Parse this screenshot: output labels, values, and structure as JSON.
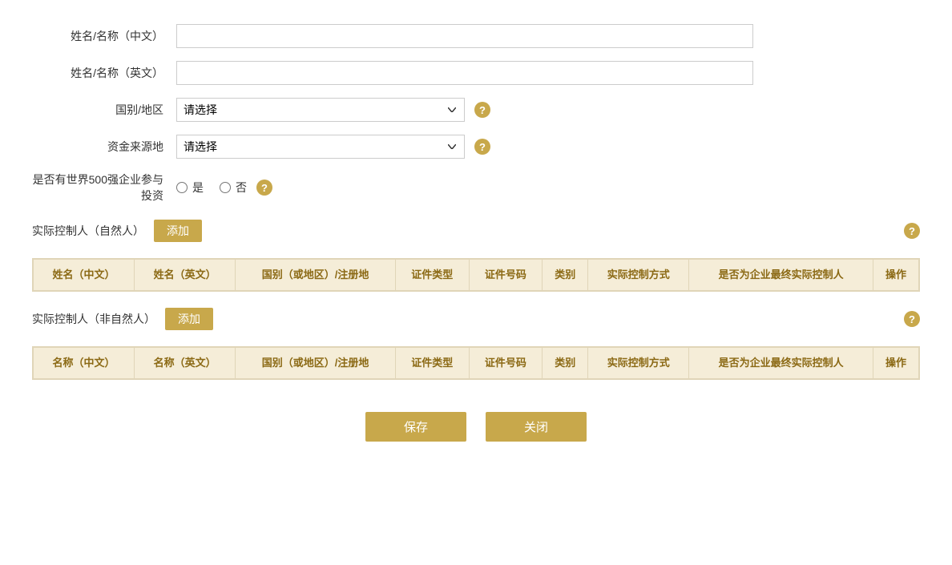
{
  "form": {
    "name_cn_label": "姓名/名称（中文）",
    "name_en_label": "姓名/名称（英文）",
    "country_label": "国别/地区",
    "country_placeholder": "请选择",
    "fund_source_label": "资金来源地",
    "fund_source_placeholder": "请选择",
    "fortune500_label": "是否有世界500强企业参与投资",
    "radio_yes": "是",
    "radio_no": "否"
  },
  "natural_person_section": {
    "title": "实际控制人（自然人）",
    "add_button": "添加",
    "columns": [
      "姓名（中文）",
      "姓名（英文）",
      "国别（或地区）/注册地",
      "证件类型",
      "证件号码",
      "类别",
      "实际控制方式",
      "是否为企业最终实际控制人",
      "操作"
    ]
  },
  "non_natural_person_section": {
    "title": "实际控制人（非自然人）",
    "add_button": "添加",
    "columns": [
      "名称（中文）",
      "名称（英文）",
      "国别（或地区）/注册地",
      "证件类型",
      "证件号码",
      "类别",
      "实际控制方式",
      "是否为企业最终实际控制人",
      "操作"
    ]
  },
  "buttons": {
    "save": "保存",
    "close": "关闭"
  },
  "help_icon": "?"
}
